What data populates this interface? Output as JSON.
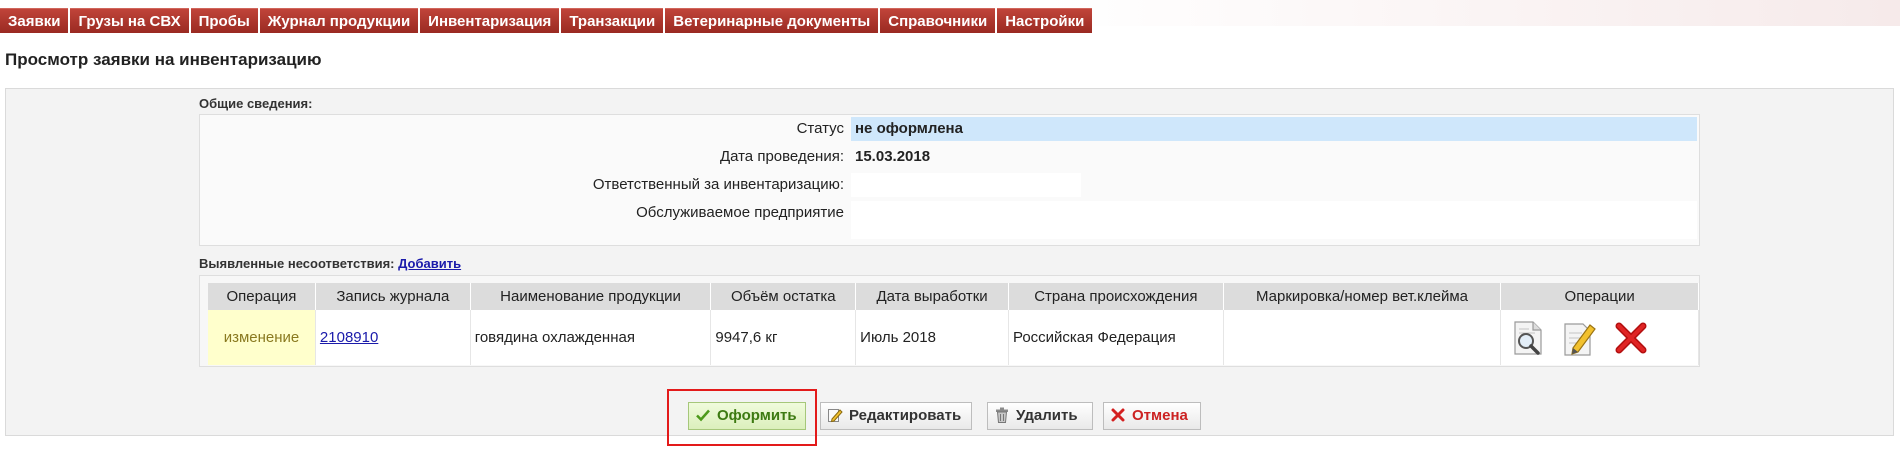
{
  "nav": {
    "tabs": [
      "Заявки",
      "Грузы на СВХ",
      "Пробы",
      "Журнал продукции",
      "Инвентаризация",
      "Транзакции",
      "Ветеринарные документы",
      "Справочники",
      "Настройки"
    ]
  },
  "page": {
    "title": "Просмотр заявки на инвентаризацию"
  },
  "general": {
    "heading": "Общие сведения:",
    "rows": [
      {
        "label": "Статус",
        "value": "не оформлена"
      },
      {
        "label": "Дата проведения:",
        "value": "15.03.2018"
      },
      {
        "label": "Ответственный за инвентаризацию:",
        "value": ""
      },
      {
        "label": "Обслуживаемое предприятие",
        "value": ""
      }
    ]
  },
  "discrepancies": {
    "heading": "Выявленные несоответствия:",
    "add_link": "Добавить",
    "columns": [
      "Операция",
      "Запись журнала",
      "Наименование продукции",
      "Объём остатка",
      "Дата выработки",
      "Страна происхождения",
      "Маркировка/номер вет.клейма",
      "Операции"
    ],
    "rows": [
      {
        "operation": "изменение",
        "journal": "2108910",
        "product": "говядина охлажденная",
        "volume": "9947,6 кг",
        "date": "Июль 2018",
        "country": "Российская Федерация",
        "marking": ""
      }
    ],
    "row_actions": [
      "view-icon",
      "edit-icon",
      "delete-icon"
    ]
  },
  "buttons": {
    "submit": "Оформить",
    "edit": "Редактировать",
    "delete": "Удалить",
    "cancel": "Отмена"
  },
  "colors": {
    "nav_tab": "#a8332a",
    "status_highlight": "#cfe7fb",
    "operation_cell": "#ffffcc",
    "highlight_frame": "#e31a1a"
  }
}
